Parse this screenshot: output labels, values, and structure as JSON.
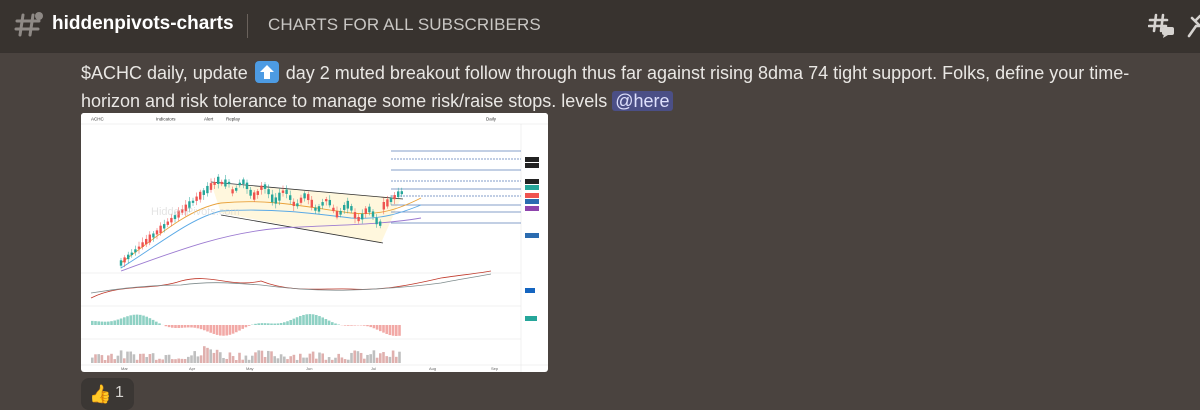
{
  "header": {
    "channel_name": "hiddenpivots-charts",
    "topic": "CHARTS FOR ALL SUBSCRIBERS"
  },
  "message": {
    "text_before": "$ACHC daily, update ",
    "emoji": "up-arrow-emoji",
    "text_after": " day 2 muted breakout follow through thus far against rising 8dma 74 tight support. Folks, define your time-horizon and risk tolerance to manage some risk/raise stops. levels ",
    "mention": "@here"
  },
  "chart": {
    "symbol": "ACHC",
    "toolbar": {
      "indicators": "Indicators",
      "alert": "Alert",
      "replay": "Replay",
      "interval": "Daily"
    },
    "watermark": "HiddenPivots.com",
    "months": [
      "Mar",
      "Apr",
      "May",
      "Jun",
      "Jul",
      "Aug",
      "Sep"
    ],
    "colors": {
      "up": "#26a69a",
      "down": "#ef5350"
    }
  },
  "reaction": {
    "emoji": "👍",
    "count": "1"
  },
  "colors": {
    "background": "#4a433f",
    "header": "#38332f",
    "mention_bg": "#4b4f86"
  }
}
